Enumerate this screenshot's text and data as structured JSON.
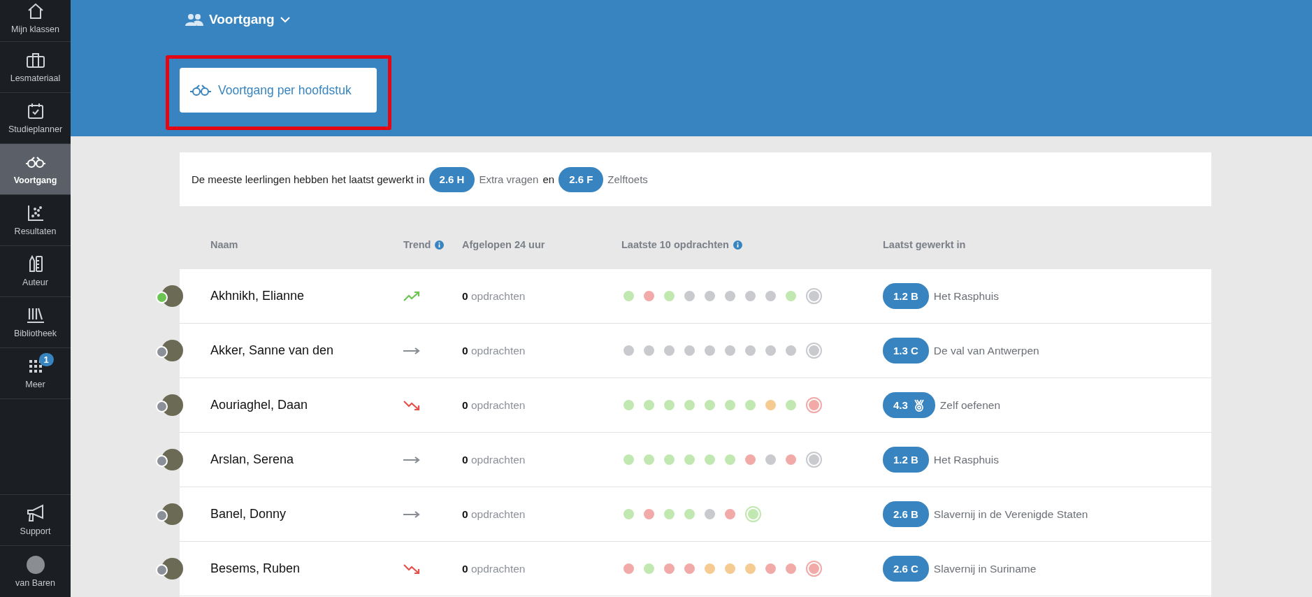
{
  "sidebar": {
    "items": [
      {
        "label": "Mijn klassen",
        "kind": "home",
        "selected": false
      },
      {
        "label": "Lesmateriaal",
        "kind": "briefcase",
        "selected": false
      },
      {
        "label": "Studieplanner",
        "kind": "calendar",
        "selected": false
      },
      {
        "label": "Voortgang",
        "kind": "glasses",
        "selected": true
      },
      {
        "label": "Resultaten",
        "kind": "scatter",
        "selected": false
      },
      {
        "label": "Auteur",
        "kind": "pencil",
        "selected": false
      },
      {
        "label": "Bibliotheek",
        "kind": "books",
        "selected": false
      },
      {
        "label": "Meer",
        "kind": "grid",
        "selected": false,
        "badge": "1"
      }
    ],
    "bottom": [
      {
        "label": "Support",
        "kind": "megaphone"
      },
      {
        "label": "van Baren",
        "kind": "avatar"
      }
    ]
  },
  "header": {
    "title": "Voortgang",
    "button": "Voortgang per hoofdstuk"
  },
  "summary": {
    "text": "De meeste leerlingen hebben het laatst gewerkt in",
    "badge_1": "2.6 H",
    "label_1": "Extra vragen",
    "joiner": "en",
    "badge_2": "2.6 F",
    "label_2": "Zelftoets"
  },
  "table": {
    "columns": [
      {
        "label": "Naam",
        "info": false
      },
      {
        "label": "Trend",
        "info": true
      },
      {
        "label": "Afgelopen 24 uur",
        "info": false
      },
      {
        "label": "Laatste 10 opdrachten",
        "info": true
      },
      {
        "label": "Laatst gewerkt in",
        "info": false
      }
    ],
    "rows": [
      {
        "name": "Akhnikh, Elianne",
        "online": true,
        "trend": {
          "kind": "up"
        },
        "count": "0",
        "count_label": "opdrachten",
        "dots": [
          {
            "color": "#c1e8b0",
            "current": false
          },
          {
            "color": "#f2aaa9",
            "current": false
          },
          {
            "color": "#c1e8b0",
            "current": false
          },
          {
            "color": "#c8cace",
            "current": false
          },
          {
            "color": "#c8cace",
            "current": false
          },
          {
            "color": "#c8cace",
            "current": false
          },
          {
            "color": "#c8cace",
            "current": false
          },
          {
            "color": "#c8cace",
            "current": false
          },
          {
            "color": "#c1e8b0",
            "current": false
          },
          {
            "color": "#c8cace",
            "current": true
          }
        ],
        "badge": {
          "text": "1.2 B",
          "kind": "chapter"
        },
        "chapter": "Het Rasphuis"
      },
      {
        "name": "Akker, Sanne van den",
        "online": false,
        "trend": {
          "kind": "flat"
        },
        "count": "0",
        "count_label": "opdrachten",
        "dots": [
          {
            "color": "#c8cace",
            "current": false
          },
          {
            "color": "#c8cace",
            "current": false
          },
          {
            "color": "#c8cace",
            "current": false
          },
          {
            "color": "#c8cace",
            "current": false
          },
          {
            "color": "#c8cace",
            "current": false
          },
          {
            "color": "#c8cace",
            "current": false
          },
          {
            "color": "#c8cace",
            "current": false
          },
          {
            "color": "#c8cace",
            "current": false
          },
          {
            "color": "#c8cace",
            "current": false
          },
          {
            "color": "#c8cace",
            "current": true
          }
        ],
        "badge": {
          "text": "1.3 C",
          "kind": "chapter"
        },
        "chapter": "De val van Antwerpen"
      },
      {
        "name": "Aouriaghel, Daan",
        "online": false,
        "trend": {
          "kind": "down"
        },
        "count": "0",
        "count_label": "opdrachten",
        "dots": [
          {
            "color": "#c1e8b0",
            "current": false
          },
          {
            "color": "#c1e8b0",
            "current": false
          },
          {
            "color": "#c1e8b0",
            "current": false
          },
          {
            "color": "#c1e8b0",
            "current": false
          },
          {
            "color": "#c1e8b0",
            "current": false
          },
          {
            "color": "#c1e8b0",
            "current": false
          },
          {
            "color": "#c1e8b0",
            "current": false
          },
          {
            "color": "#f6cb92",
            "current": false
          },
          {
            "color": "#c1e8b0",
            "current": false
          },
          {
            "color": "#f2aaa9",
            "current": true
          }
        ],
        "badge": {
          "text": "4.3",
          "kind": "medal"
        },
        "chapter": "Zelf oefenen"
      },
      {
        "name": "Arslan, Serena",
        "online": false,
        "trend": {
          "kind": "flat"
        },
        "count": "0",
        "count_label": "opdrachten",
        "dots": [
          {
            "color": "#c1e8b0",
            "current": false
          },
          {
            "color": "#c1e8b0",
            "current": false
          },
          {
            "color": "#c1e8b0",
            "current": false
          },
          {
            "color": "#c1e8b0",
            "current": false
          },
          {
            "color": "#c1e8b0",
            "current": false
          },
          {
            "color": "#c1e8b0",
            "current": false
          },
          {
            "color": "#f2aaa9",
            "current": false
          },
          {
            "color": "#c8cace",
            "current": false
          },
          {
            "color": "#f2aaa9",
            "current": false
          },
          {
            "color": "#c8cace",
            "current": true
          }
        ],
        "badge": {
          "text": "1.2 B",
          "kind": "chapter"
        },
        "chapter": "Het Rasphuis"
      },
      {
        "name": "Banel, Donny",
        "online": false,
        "trend": {
          "kind": "flat"
        },
        "count": "0",
        "count_label": "opdrachten",
        "dots": [
          {
            "color": "#c1e8b0",
            "current": false
          },
          {
            "color": "#f2aaa9",
            "current": false
          },
          {
            "color": "#c1e8b0",
            "current": false
          },
          {
            "color": "#c1e8b0",
            "current": false
          },
          {
            "color": "#c8cace",
            "current": false
          },
          {
            "color": "#f2aaa9",
            "current": false
          },
          {
            "color": "#c1e8b0",
            "current": true
          }
        ],
        "badge": {
          "text": "2.6 B",
          "kind": "chapter"
        },
        "chapter": "Slavernij in de Verenigde Staten"
      },
      {
        "name": "Besems, Ruben",
        "online": false,
        "trend": {
          "kind": "down"
        },
        "count": "0",
        "count_label": "opdrachten",
        "dots": [
          {
            "color": "#f2aaa9",
            "current": false
          },
          {
            "color": "#c1e8b0",
            "current": false
          },
          {
            "color": "#f2aaa9",
            "current": false
          },
          {
            "color": "#f2aaa9",
            "current": false
          },
          {
            "color": "#f6cb92",
            "current": false
          },
          {
            "color": "#f6cb92",
            "current": false
          },
          {
            "color": "#f6cb92",
            "current": false
          },
          {
            "color": "#f2aaa9",
            "current": false
          },
          {
            "color": "#f2aaa9",
            "current": false
          },
          {
            "color": "#f2aaa9",
            "current": true
          }
        ],
        "badge": {
          "text": "2.6 C",
          "kind": "chapter"
        },
        "chapter": "Slavernij in Suriname"
      }
    ]
  }
}
